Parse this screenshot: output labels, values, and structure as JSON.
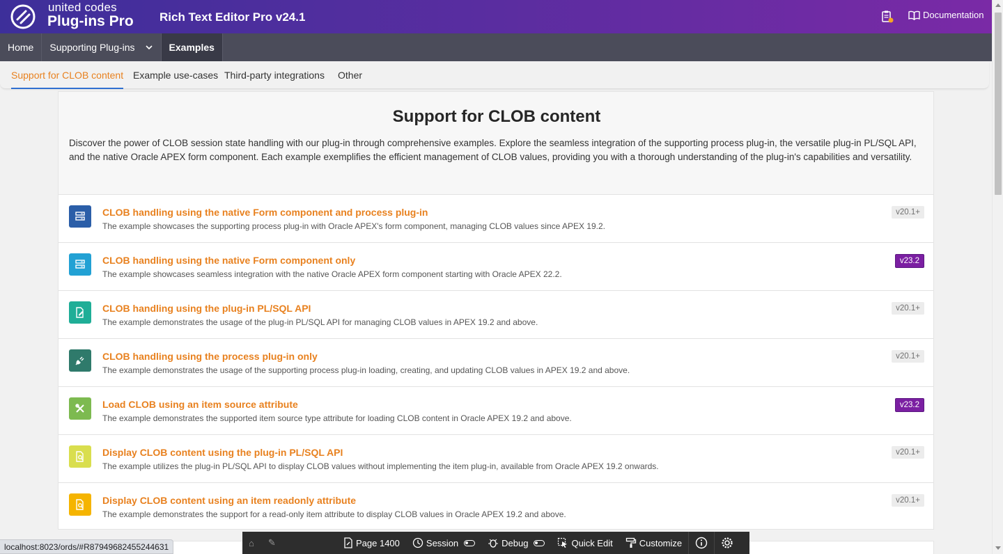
{
  "header": {
    "brand_top": "united codes",
    "brand_bottom": "Plug-ins Pro",
    "app_title": "Rich Text Editor Pro v24.1",
    "documentation_label": "Documentation",
    "clipboard_icon": "clipboard-alert-icon",
    "book_icon": "book-open-icon"
  },
  "topnav": {
    "items": [
      {
        "label": "Home"
      },
      {
        "label": "Supporting Plug-ins"
      },
      {
        "label": "Examples"
      }
    ]
  },
  "tabs": [
    {
      "label": "Support for CLOB content"
    },
    {
      "label": "Example use-cases"
    },
    {
      "label": "Third-party integrations"
    },
    {
      "label": "Other"
    }
  ],
  "main": {
    "title": "Support for CLOB content",
    "description": "Discover the power of CLOB session state handling with our plug-in through comprehensive examples. Explore the seamless integration of the supporting process plug-in, the versatile plug-in PL/SQL API, and the native Oracle APEX form component. Each example exemplifies the efficient management of CLOB values, providing you with a thorough understanding of the plug-in's capabilities and versatility.",
    "items": [
      {
        "title": "CLOB handling using the native Form component and process plug-in",
        "desc": "The example showcases the supporting process plug-in with Oracle APEX's form component, managing CLOB values since APEX 19.2.",
        "badge": "v20.1+",
        "icon": "form-icon",
        "color": "#2b5ea8"
      },
      {
        "title": "CLOB handling using the native Form component only",
        "desc": "The example showcases seamless integration with the native Oracle APEX form component starting with Oracle APEX 22.2.",
        "badge": "v23.2",
        "icon": "form-icon",
        "color": "#22a1d4"
      },
      {
        "title": "CLOB handling using the plug-in PL/SQL API",
        "desc": "The example demonstrates the usage of the plug-in PL/SQL API for managing CLOB values in APEX 19.2 and above.",
        "badge": "v20.1+",
        "icon": "file-edit-icon",
        "color": "#1fae97"
      },
      {
        "title": "CLOB handling using the process plug-in only",
        "desc": "The example demonstrates the usage of the supporting process plug-in loading, creating, and updating CLOB values in APEX 19.2 and above.",
        "badge": "v20.1+",
        "icon": "plug-icon",
        "color": "#2f7a6b"
      },
      {
        "title": "Load CLOB using an item source attribute",
        "desc": "The example demonstrates the supported item source type attribute for loading CLOB content in Oracle APEX 19.2 and above.",
        "badge": "v23.2",
        "icon": "tools-icon",
        "color": "#7dba50"
      },
      {
        "title": "Display CLOB content using the plug-in PL/SQL API",
        "desc": "The example utilizes the plug-in PL/SQL API to display CLOB values without implementing the item plug-in, available from Oracle APEX 19.2 onwards.",
        "badge": "v20.1+",
        "icon": "file-search-icon",
        "color": "#d9de4e"
      },
      {
        "title": "Display CLOB content using an item readonly attribute",
        "desc": "The example demonstrates the support for a read-only item attribute to display CLOB values in Oracle APEX 19.2 and above.",
        "badge": "v20.1+",
        "icon": "file-search-icon",
        "color": "#f5b400"
      }
    ]
  },
  "devbar": {
    "page": "Page 1400",
    "session": "Session",
    "debug": "Debug",
    "quick_edit": "Quick Edit",
    "customize": "Customize"
  },
  "status_url": "localhost:8023/ords/#R87949682455244631"
}
